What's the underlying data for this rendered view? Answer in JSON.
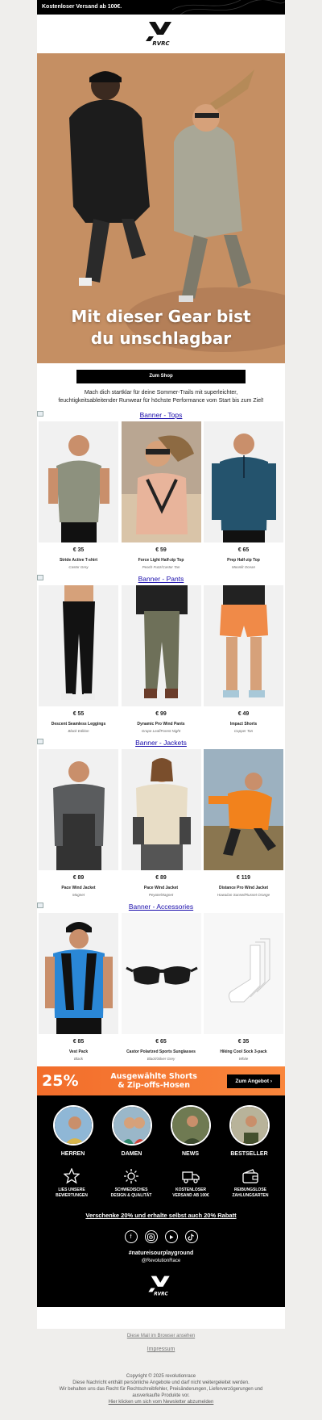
{
  "shipping_bar": {
    "text": "Kostenloser Versand ab 100€."
  },
  "brand": {
    "logo_text": "RVRC"
  },
  "hero": {
    "title_line1": "Mit dieser Gear bist",
    "title_line2": "du unschlagbar"
  },
  "cta": {
    "label": "Zum Shop"
  },
  "intro": {
    "text": "Mach dich startklar für deine Sommer-Trails mit superleichter, feuchtigkeitsableitender Runwear für höchste Performance vom Start bis zum Ziel!"
  },
  "sections": [
    {
      "banner": "Banner - Tops",
      "products": [
        {
          "price": "€ 35",
          "name": "Stride Active T-shirt",
          "color": "Castor Grey"
        },
        {
          "price": "€ 59",
          "name": "Force Light Half-zip Top",
          "color": "Peach Fuzz/Castor Tan"
        },
        {
          "price": "€ 65",
          "name": "Prep Half-zip Top",
          "color": "Moonlit Ocean"
        }
      ]
    },
    {
      "banner": "Banner - Pants",
      "products": [
        {
          "price": "€ 55",
          "name": "Descent Seamless Leggings",
          "color": "Black Edition"
        },
        {
          "price": "€ 99",
          "name": "Dynamic Pro Wind Pants",
          "color": "Grape Leaf/Forest Night"
        },
        {
          "price": "€ 49",
          "name": "Impact Shorts",
          "color": "Copper Tan"
        }
      ]
    },
    {
      "banner": "Banner - Jackets",
      "products": [
        {
          "price": "€ 89",
          "name": "Pace Wind Jacket",
          "color": "Magnet"
        },
        {
          "price": "€ 89",
          "name": "Pace Wind Jacket",
          "color": "Peyote/Magnet"
        },
        {
          "price": "€ 119",
          "name": "Distance Pro Wind Jacket",
          "color": "Hawaiian Sunset/Russet Orange"
        }
      ]
    },
    {
      "banner": "Banner - Accessories",
      "products": [
        {
          "price": "€ 85",
          "name": "Vest Pack",
          "color": "Black"
        },
        {
          "price": "€ 65",
          "name": "Castor Polarized Sports Sunglasses",
          "color": "Black/Silver Grey"
        },
        {
          "price": "€ 35",
          "name": "Hiking Cool Sock 3-pack",
          "color": "White"
        }
      ]
    }
  ],
  "promo": {
    "percent": "25%",
    "line1": "Ausgewählte Shorts",
    "line2": "& Zip-offs-Hosen",
    "button": "Zum Angebot ›"
  },
  "categories": [
    {
      "label": "HERREN"
    },
    {
      "label": "DAMEN"
    },
    {
      "label": "NEWS"
    },
    {
      "label": "BESTSELLER"
    }
  ],
  "usps": [
    {
      "line1": "LIES UNSERE",
      "line2": "BEWERTUNGEN",
      "icon": "star-icon"
    },
    {
      "line1": "SCHWEDISCHES",
      "line2": "DESIGN & QUALITÄT",
      "icon": "sun-icon"
    },
    {
      "line1": "KOSTENLOSER",
      "line2": "VERSAND AB 100€",
      "icon": "truck-icon"
    },
    {
      "line1": "REIBUNGSLOSE",
      "line2": "ZAHLUNGSARTEN",
      "icon": "wallet-icon"
    }
  ],
  "refer": {
    "text": "Verschenke 20% und erhalte selbst auch 20% Rabatt"
  },
  "social": {
    "hashtag": "#natureisourplayground",
    "handle": "@RevolutionRace"
  },
  "links": {
    "browser": "Diese Mail im Browser ansehen",
    "impressum": "Impressum"
  },
  "footer": {
    "copyright": "Copyright © 2025 revolutionrace",
    "line1": "Diese Nachricht enthält persönliche Angebote und darf nicht weitergeleitet werden.",
    "line2": "Wir behalten uns das Recht für Rechtschreibfehler, Preisänderungen, Lieferverzögerungen und",
    "line3": "ausverkaufte Produkte vor.",
    "unsubscribe": "Hier klicken um sich vom Newsletter abzumelden"
  },
  "colors": {
    "accent_orange": "#f26d2b",
    "link_blue": "#1a0dab",
    "black": "#000000"
  }
}
